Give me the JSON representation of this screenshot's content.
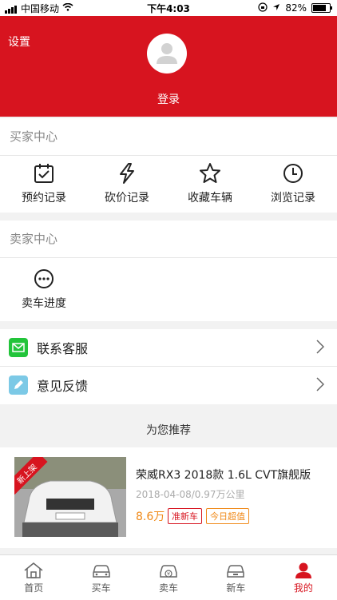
{
  "status": {
    "carrier": "中国移动",
    "time": "下午4:03",
    "battery": "82%"
  },
  "hero": {
    "settings": "设置",
    "login": "登录"
  },
  "buyer": {
    "title": "买家中心",
    "items": [
      {
        "label": "预约记录",
        "icon": "calendar-check-icon"
      },
      {
        "label": "砍价记录",
        "icon": "lightning-icon"
      },
      {
        "label": "收藏车辆",
        "icon": "star-icon"
      },
      {
        "label": "浏览记录",
        "icon": "clock-icon"
      }
    ]
  },
  "seller": {
    "title": "卖家中心",
    "items": [
      {
        "label": "卖车进度",
        "icon": "more-circle-icon"
      }
    ]
  },
  "menu": [
    {
      "label": "联系客服",
      "color": "#22c43a",
      "icon": "mail-icon"
    },
    {
      "label": "意见反馈",
      "color": "#7cc9e6",
      "icon": "pencil-icon"
    }
  ],
  "recommend": {
    "title": "为您推荐",
    "car": {
      "badge": "新上架",
      "title": "荣威RX3 2018款 1.6L CVT旗舰版",
      "meta": "2018-04-08/0.97万公里",
      "price": "8.6万",
      "tags": [
        "准新车",
        "今日超值"
      ]
    }
  },
  "tabs": [
    {
      "label": "首页",
      "icon": "home-icon"
    },
    {
      "label": "买车",
      "icon": "car-icon"
    },
    {
      "label": "卖车",
      "icon": "sell-car-icon"
    },
    {
      "label": "新车",
      "icon": "new-car-icon"
    },
    {
      "label": "我的",
      "icon": "profile-icon"
    }
  ],
  "colors": {
    "brand": "#d7141f",
    "price": "#f08a1a"
  }
}
